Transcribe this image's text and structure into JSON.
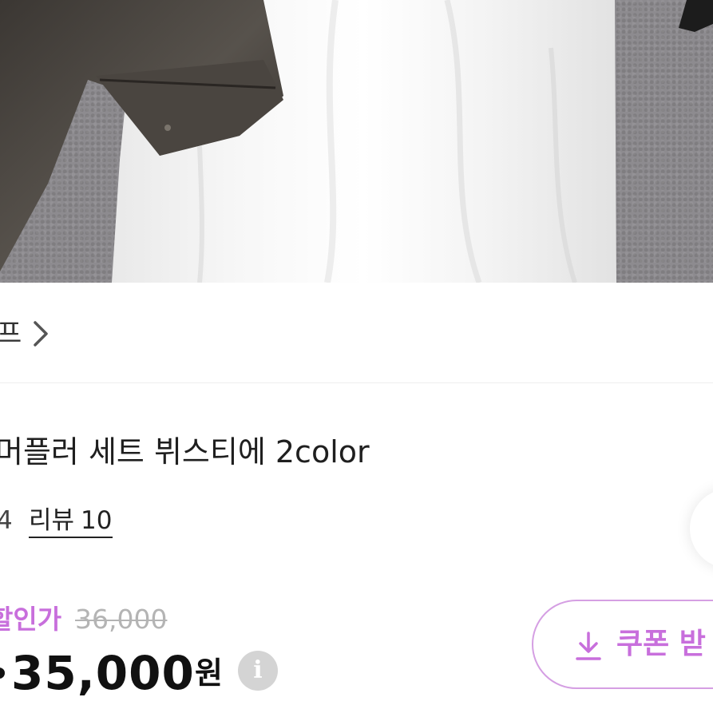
{
  "product_image": {
    "alt": ""
  },
  "shop": {
    "name": "프",
    "chevron_icon": "chevron-right-icon"
  },
  "product": {
    "title": "머플러 세트 뷔스티에 2color",
    "rating": "4",
    "review_label": "리뷰",
    "review_count": "10"
  },
  "price": {
    "discount_label": "할인가",
    "original_price": "36,000",
    "sale_price": "35,000",
    "currency": "원",
    "info_icon": "info-icon",
    "info_glyph": "i"
  },
  "coupon": {
    "label": "쿠폰 받",
    "icon": "download-icon",
    "accent_color": "#c86fdc",
    "border_color": "#d59fe3"
  },
  "colors": {
    "discount": "#c86fdc",
    "original_price": "#b4b4b4",
    "text_primary": "#111111"
  }
}
